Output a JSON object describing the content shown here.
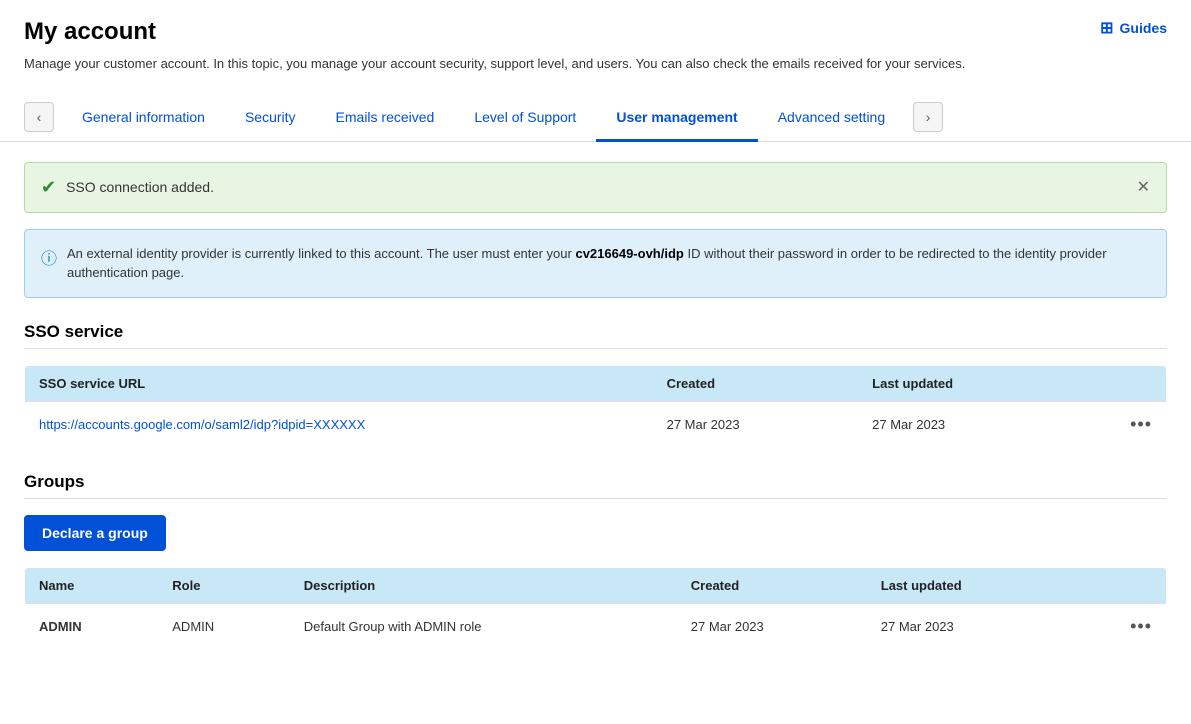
{
  "page": {
    "title": "My account",
    "description": "Manage your customer account. In this topic, you manage your account security, support level, and users. You can also check the emails received for your services.",
    "guides_label": "Guides"
  },
  "tabs": [
    {
      "id": "general",
      "label": "General information",
      "active": false
    },
    {
      "id": "security",
      "label": "Security",
      "active": false
    },
    {
      "id": "emails",
      "label": "Emails received",
      "active": false
    },
    {
      "id": "support",
      "label": "Level of Support",
      "active": false
    },
    {
      "id": "users",
      "label": "User management",
      "active": true
    },
    {
      "id": "advanced",
      "label": "Advanced setting",
      "active": false
    }
  ],
  "success_banner": {
    "text": "SSO connection added."
  },
  "info_banner": {
    "text_before": "An external identity provider is currently linked to this account. The user must enter your ",
    "highlight": "cv216649-ovh/idp",
    "text_after": " ID without their password in order to be redirected to the identity provider authentication page."
  },
  "sso_section": {
    "title": "SSO service",
    "table": {
      "headers": [
        "SSO service URL",
        "Created",
        "Last updated",
        ""
      ],
      "rows": [
        {
          "url": "https://accounts.google.com/o/saml2/idp?idpid=XXXXXX",
          "created": "27 Mar 2023",
          "last_updated": "27 Mar 2023"
        }
      ]
    }
  },
  "groups_section": {
    "title": "Groups",
    "declare_button_label": "Declare a group",
    "table": {
      "headers": [
        "Name",
        "Role",
        "Description",
        "Created",
        "Last updated",
        ""
      ],
      "rows": [
        {
          "name": "ADMIN",
          "role": "ADMIN",
          "description": "Default Group with ADMIN role",
          "created": "27 Mar 2023",
          "last_updated": "27 Mar 2023"
        }
      ]
    }
  }
}
